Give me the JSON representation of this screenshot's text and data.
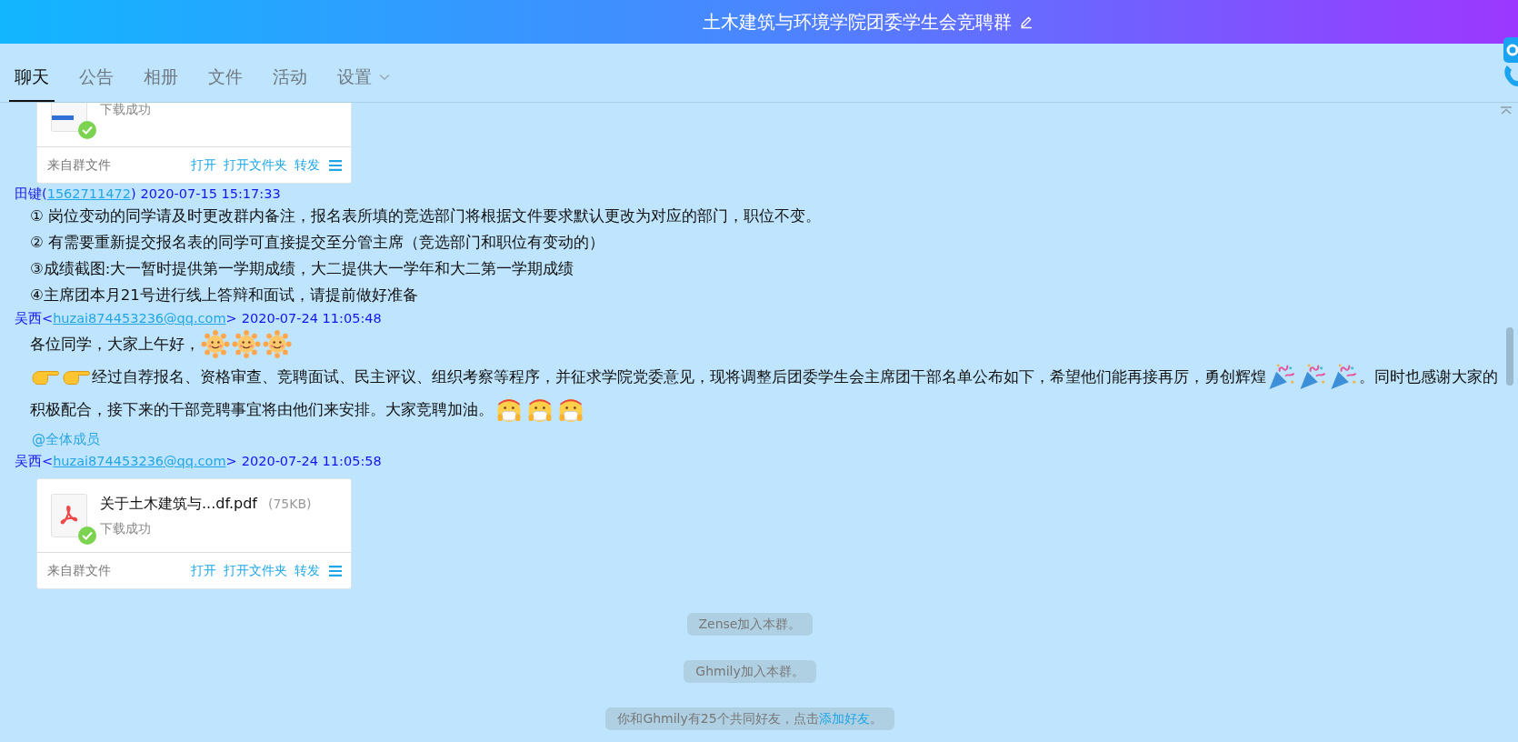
{
  "header": {
    "title": "土木建筑与环境学院团委学生会竞聘群"
  },
  "tabs": [
    {
      "label": "聊天",
      "selected": true,
      "dropdown": false
    },
    {
      "label": "公告",
      "selected": false,
      "dropdown": false
    },
    {
      "label": "相册",
      "selected": false,
      "dropdown": false
    },
    {
      "label": "文件",
      "selected": false,
      "dropdown": false
    },
    {
      "label": "活动",
      "selected": false,
      "dropdown": false
    },
    {
      "label": "设置",
      "selected": false,
      "dropdown": true
    }
  ],
  "messages": [
    {
      "kind": "file",
      "file": {
        "kind": "doc",
        "status": "下载成功",
        "source": "来自群文件",
        "actions": [
          "打开",
          "打开文件夹",
          "转发"
        ]
      }
    },
    {
      "kind": "text",
      "sender": {
        "before": "田键(",
        "link": "1562711472",
        "after": ")",
        "time": "2020-07-15 15:17:33"
      },
      "lines": [
        [
          {
            "kind": "text",
            "text": "① 岗位变动的同学请及时更改群内备注，报名表所填的竞选部门将根据文件要求默认更改为对应的部门，职位不变。"
          }
        ],
        [
          {
            "kind": "text",
            "text": "② 有需要重新提交报名表的同学可直接提交至分管主席（竞选部门和职位有变动的）"
          }
        ],
        [
          {
            "kind": "text",
            "text": "③成绩截图:大一暂时提供第一学期成绩，大二提供大一学年和大二第一学期成绩"
          }
        ],
        [
          {
            "kind": "text",
            "text": "④主席团本月21号进行线上答辩和面试，请提前做好准备"
          }
        ]
      ]
    },
    {
      "kind": "text",
      "sender": {
        "before": "吴西<",
        "link": "huzai874453236@qq.com",
        "after": ">",
        "time": "2020-07-24 11:05:48"
      },
      "lines": [
        [
          {
            "kind": "text",
            "text": "各位同学，大家上午好，"
          },
          {
            "kind": "sun"
          },
          {
            "kind": "sun"
          },
          {
            "kind": "sun"
          }
        ],
        [
          {
            "kind": "hand"
          },
          {
            "kind": "hand"
          },
          {
            "kind": "text",
            "text": "经过自荐报名、资格审查、竞聘面试、民主评议、组织考察等程序，并征求学院党委意见，现将调整后团委学生会主席团干部名单公布如下，希望他们能再接再厉，勇创辉煌"
          },
          {
            "kind": "popper"
          },
          {
            "kind": "popper"
          },
          {
            "kind": "popper"
          },
          {
            "kind": "text",
            "text": "。同时也感谢大家的"
          }
        ],
        [
          {
            "kind": "text",
            "text": "积极配合，接下来的干部竞聘事宜将由他们来安排。大家竞聘加油。"
          },
          {
            "kind": "mask"
          },
          {
            "kind": "mask"
          },
          {
            "kind": "mask"
          }
        ]
      ],
      "mention": "@全体成员"
    },
    {
      "kind": "file",
      "sender": {
        "before": "吴西<",
        "link": "huzai874453236@qq.com",
        "after": ">",
        "time": "2020-07-24 11:05:58"
      },
      "file": {
        "kind": "pdf",
        "name": "关于土木建筑与...df.pdf",
        "size": "(75KB)",
        "status": "下载成功",
        "source": "来自群文件",
        "actions": [
          "打开",
          "打开文件夹",
          "转发"
        ]
      }
    }
  ],
  "notices": [
    {
      "segments": [
        {
          "text": "Zense加入本群。",
          "link": false
        }
      ]
    },
    {
      "segments": [
        {
          "text": "Ghmily加入本群。",
          "link": false
        }
      ]
    },
    {
      "segments": [
        {
          "text": "你和Ghmily有25个共同好友，点击",
          "link": false
        },
        {
          "text": "添加好友",
          "link": true
        },
        {
          "text": "。",
          "link": false
        }
      ]
    }
  ]
}
